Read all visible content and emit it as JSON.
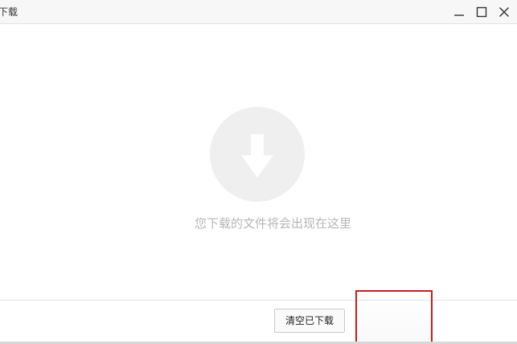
{
  "window": {
    "title": "下载"
  },
  "controls": {
    "minimize_icon": "minimize-icon",
    "maximize_icon": "maximize-icon",
    "close_icon": "close-icon"
  },
  "empty_state": {
    "icon": "download-arrow-icon",
    "message": "您下载的文件将会出现在这里"
  },
  "footer": {
    "clear_button_label": "清空已下载"
  },
  "colors": {
    "highlight_border": "#c81e1e",
    "empty_circle": "#efefef",
    "empty_text": "#b6b6b6"
  }
}
